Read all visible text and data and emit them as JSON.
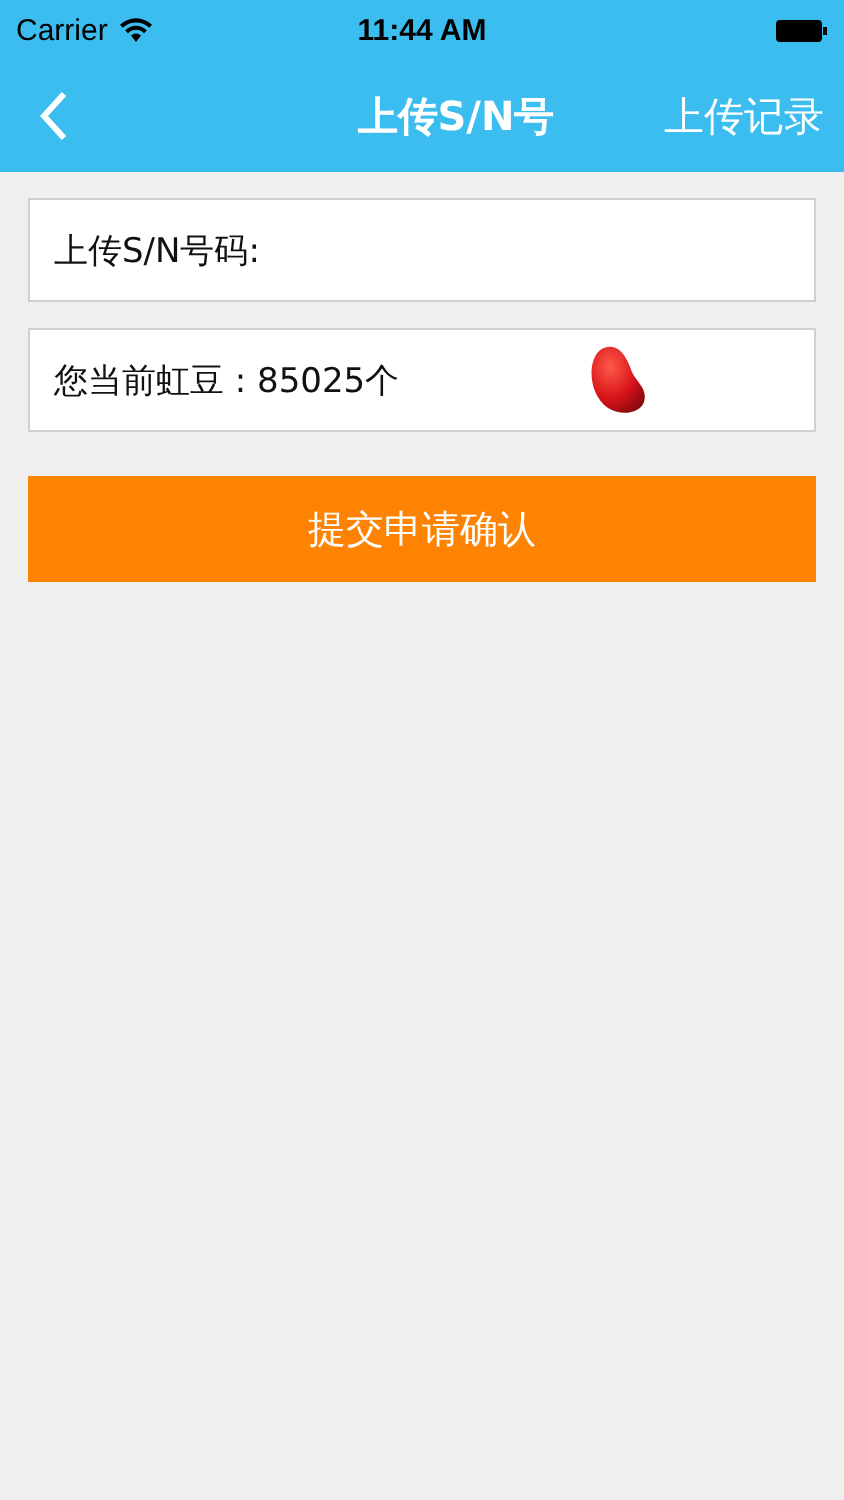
{
  "status_bar": {
    "carrier": "Carrier",
    "time": "11:44 AM"
  },
  "nav_bar": {
    "title": "上传S/N号",
    "action": "上传记录"
  },
  "sn_field": {
    "label": "上传S/N号码:"
  },
  "beans": {
    "text": "您当前虹豆 : 85025个"
  },
  "submit_button": {
    "label": "提交申请确认"
  }
}
